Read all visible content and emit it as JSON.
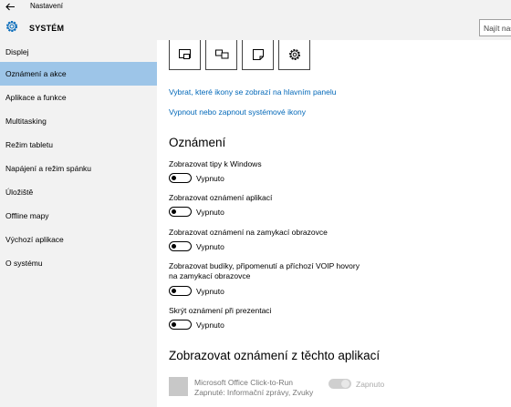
{
  "window": {
    "title": "Nastavení"
  },
  "header": {
    "section_title": "SYSTÉM",
    "search_placeholder": "Najít nastavení"
  },
  "sidebar": {
    "items": [
      {
        "label": "Displej",
        "active": false
      },
      {
        "label": "Oznámení a akce",
        "active": true
      },
      {
        "label": "Aplikace a funkce",
        "active": false
      },
      {
        "label": "Multitasking",
        "active": false
      },
      {
        "label": "Režim tabletu",
        "active": false
      },
      {
        "label": "Napájení a režim spánku",
        "active": false
      },
      {
        "label": "Úložiště",
        "active": false
      },
      {
        "label": "Offline mapy",
        "active": false
      },
      {
        "label": "Výchozí aplikace",
        "active": false
      },
      {
        "label": "O systému",
        "active": false
      }
    ]
  },
  "quick_actions": [
    {
      "icon": "tablet-mode-icon"
    },
    {
      "icon": "project-icon"
    },
    {
      "icon": "note-icon"
    },
    {
      "icon": "settings-icon"
    }
  ],
  "links": {
    "taskbar_icons": "Vybrat, které ikony se zobrazí na hlavním panelu",
    "system_icons": "Vypnout nebo zapnout systémové ikony"
  },
  "notifications": {
    "heading": "Oznámení",
    "options": [
      {
        "label": "Zobrazovat tipy k Windows",
        "state": "Vypnuto"
      },
      {
        "label": "Zobrazovat oznámení aplikací",
        "state": "Vypnuto"
      },
      {
        "label": "Zobrazovat oznámení na zamykací obrazovce",
        "state": "Vypnuto"
      },
      {
        "label": "Zobrazovat budíky, připomenutí a příchozí VOIP hovory na zamykací obrazovce",
        "state": "Vypnuto"
      },
      {
        "label": "Skrýt oznámení při prezentaci",
        "state": "Vypnuto"
      }
    ]
  },
  "apps_section": {
    "heading": "Zobrazovat oznámení z těchto aplikací",
    "apps": [
      {
        "name": "Microsoft Office Click-to-Run",
        "subtitle": "Zapnuté: Informační zprávy, Zvuky",
        "state": "Zapnuto"
      }
    ]
  },
  "colors": {
    "accent": "#0067b8",
    "active_nav": "#9dc5e8",
    "sidebar_bg": "#f2f2f2"
  }
}
